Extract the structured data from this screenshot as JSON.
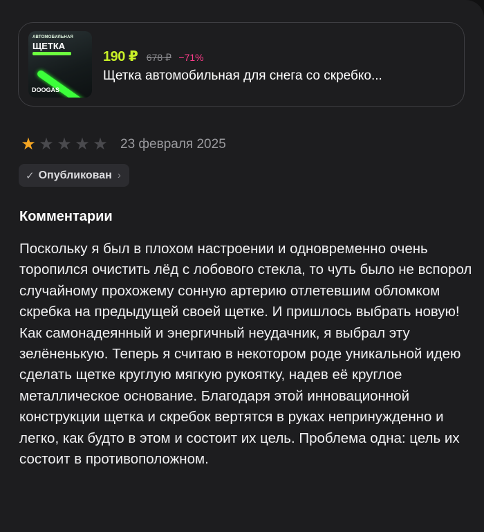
{
  "product": {
    "image_texts": {
      "top": "АВТОМОБИЛЬНАЯ",
      "name": "ЩЕТКА",
      "brand": "DOOGAS"
    },
    "price": "190 ₽",
    "old_price": "678 ₽",
    "discount": "−71%",
    "title": "Щетка автомобильная для снега со скребко..."
  },
  "review": {
    "rating": 1,
    "max_rating": 5,
    "date": "23 февраля 2025",
    "status": "Опубликован",
    "comments_heading": "Комментарии",
    "comment": "Поскольку я был в плохом настроении и одновременно очень торопился очистить лёд с лобового стекла, то чуть было не вспорол случайному прохожему сонную артерию отлетевшим обломком скребка на предыдущей своей щетке. И пришлось выбрать новую! Как самонадеянный и энергичный неудачник, я выбрал эту зелёненькую. Теперь я считаю в некотором роде уникальной идею сделать щетке круглую мягкую рукоятку, надев её круглое металлическое основание. Благодаря этой инновационной конструкции щетка и скребок вертятся в руках непринужденно и легко, как будто в этом и состоит их цель. Проблема одна: цель их состоит в противоположном."
  },
  "colors": {
    "background": "#1d1d1f",
    "price": "#c8f028",
    "discount": "#ff3d8b",
    "star_on": "#f5a623",
    "star_off": "#4a4a4e"
  },
  "icons": {
    "star": "star-icon",
    "check": "check-icon",
    "chevron": "chevron-right-icon"
  }
}
